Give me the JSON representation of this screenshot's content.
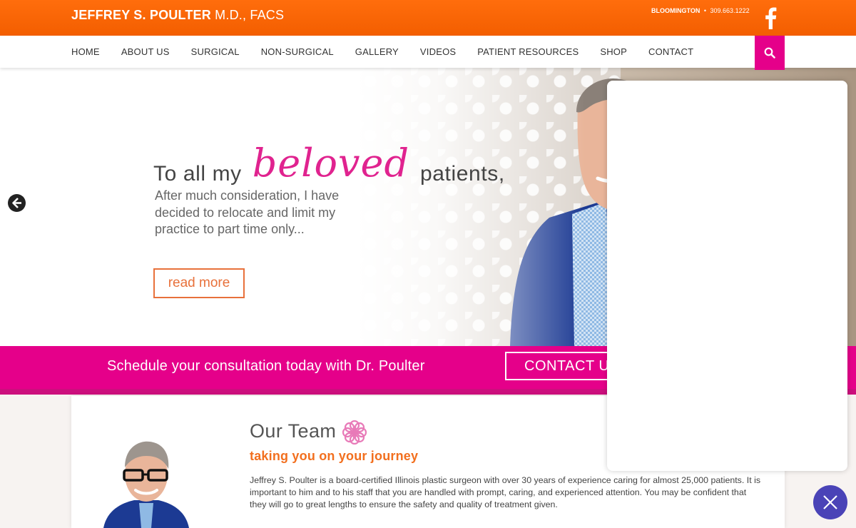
{
  "header": {
    "brand_bold": "JEFFREY S. POULTER",
    "brand_rest": " M.D., FACS",
    "city": "BLOOMINGTON",
    "separator": "•",
    "phone": "309.663.1222",
    "social_icon": "facebook-icon"
  },
  "nav": {
    "items": [
      {
        "label": "HOME"
      },
      {
        "label": "ABOUT US"
      },
      {
        "label": "SURGICAL"
      },
      {
        "label": "NON-SURGICAL"
      },
      {
        "label": "GALLERY"
      },
      {
        "label": "VIDEOS"
      },
      {
        "label": "PATIENT RESOURCES"
      },
      {
        "label": "SHOP"
      },
      {
        "label": "CONTACT"
      }
    ],
    "search_icon": "search-icon"
  },
  "hero": {
    "heading_start": "To all my",
    "heading_script": "beloved",
    "heading_end": "patients,",
    "body": "After much consideration, I have decided to relocate and limit my practice to part time only...",
    "button": "read more",
    "prev_icon": "arrow-left-icon"
  },
  "band": {
    "text": "Schedule your consultation today with Dr. Poulter",
    "button": "CONTACT US"
  },
  "team": {
    "title": "Our Team",
    "subtitle": "taking you on your journey",
    "text": "Jeffrey S. Poulter is a board-certified Illinois plastic surgeon with over 30 years of experience caring for almost 25,000 patients. It is important to him and to his staff that you are handled with prompt, caring, and experienced attention. You may be confident that they will go to great lengths to ensure the safety and quality of treatment given."
  },
  "colors": {
    "orange": "#ff6d0c",
    "pink": "#e5008a",
    "chat_button": "#4a43b7"
  },
  "overlay": {
    "close_icon": "close-icon"
  }
}
